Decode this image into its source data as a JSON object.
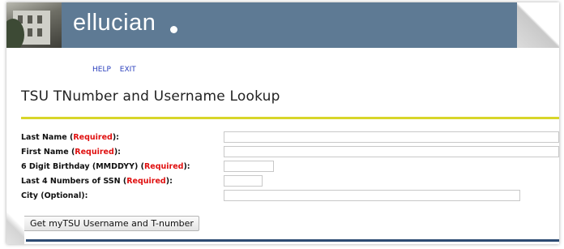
{
  "header": {
    "brand": "ellucian",
    "banner_color": "#5e7a94"
  },
  "nav": {
    "help": "HELP",
    "exit": "EXIT"
  },
  "page": {
    "title": "TSU TNumber and Username Lookup",
    "rule_color": "#d8d62a"
  },
  "form": {
    "last_name": {
      "label": "Last Name (",
      "req": "Required",
      "tail": "):",
      "value": ""
    },
    "first_name": {
      "label": "First Name (",
      "req": "Required",
      "tail": "):",
      "value": ""
    },
    "birthday": {
      "label": "6 Digit Birthday (MMDDYY) (",
      "req": "Required",
      "tail": "):",
      "value": ""
    },
    "ssn": {
      "label": "Last 4 Numbers of SSN (",
      "req": "Required",
      "tail": "):",
      "value": ""
    },
    "city": {
      "label": "City (Optional):",
      "value": ""
    },
    "submit_label": "Get myTSU Username and T-number"
  }
}
